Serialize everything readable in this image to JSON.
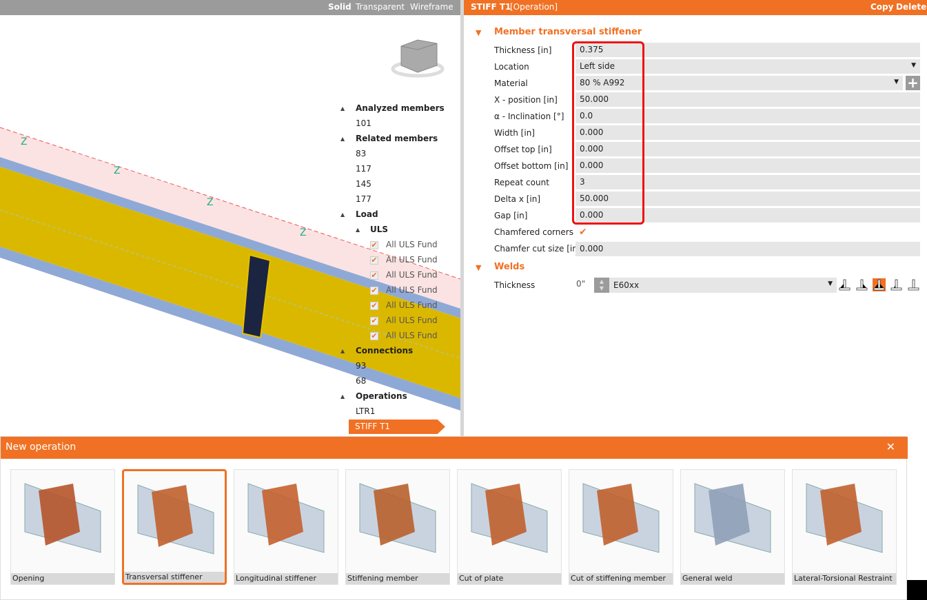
{
  "viewport": {
    "modes": [
      "Solid",
      "Transparent",
      "Wireframe"
    ],
    "active_mode": "Solid"
  },
  "tree": {
    "analyzed_members": {
      "label": "Analyzed members",
      "items": [
        "101"
      ]
    },
    "related_members": {
      "label": "Related members",
      "items": [
        "83",
        "117",
        "145",
        "177"
      ]
    },
    "load": {
      "label": "Load",
      "uls": {
        "label": "ULS",
        "items": [
          "All ULS Fund",
          "All ULS Fund",
          "All ULS Fund",
          "All ULS Fund",
          "All ULS Fund",
          "All ULS Fund",
          "All ULS Fund"
        ]
      }
    },
    "connections": {
      "label": "Connections",
      "items": [
        "93",
        "68"
      ]
    },
    "operations": {
      "label": "Operations",
      "items": [
        "LTR1",
        "STIFF T1"
      ],
      "selected": "STIFF T1"
    }
  },
  "panel": {
    "title": "STIFF T1",
    "subtitle": "[Operation]",
    "copy": "Copy",
    "delete": "Delete",
    "section1": "Member transversal stiffener",
    "props": [
      {
        "label": "Thickness [in]",
        "value": "0.375"
      },
      {
        "label": "Location",
        "value": "Left side"
      },
      {
        "label": "Material",
        "value": "80 % A992"
      },
      {
        "label": "X - position [in]",
        "value": "50.000"
      },
      {
        "label": "α - Inclination [°]",
        "value": "0.0"
      },
      {
        "label": "Width [in]",
        "value": "0.000"
      },
      {
        "label": "Offset top [in]",
        "value": "0.000"
      },
      {
        "label": "Offset bottom [in]",
        "value": "0.000"
      },
      {
        "label": "Repeat count",
        "value": "3"
      },
      {
        "label": "Delta x [in]",
        "value": "50.000"
      },
      {
        "label": "Gap [in]",
        "value": "0.000"
      }
    ],
    "chamfered": {
      "label": "Chamfered corners",
      "checked": true
    },
    "chamfer_size": {
      "label": "Chamfer cut size [in]",
      "value": "0.000"
    },
    "section2": "Welds",
    "weld": {
      "label": "Thickness",
      "value": "0\"",
      "material": "E60xx"
    }
  },
  "new_operation": {
    "title": "New operation",
    "tiles": [
      "Opening",
      "Transversal stiffener",
      "Longitudinal stiffener",
      "Stiffening member",
      "Cut of plate",
      "Cut of stiffening member",
      "General weld",
      "Lateral-Torsional Restraint"
    ],
    "selected": "Transversal stiffener"
  },
  "colors": {
    "accent": "#f07124",
    "highlight": "#ee1111",
    "beam": "#dbb600"
  }
}
